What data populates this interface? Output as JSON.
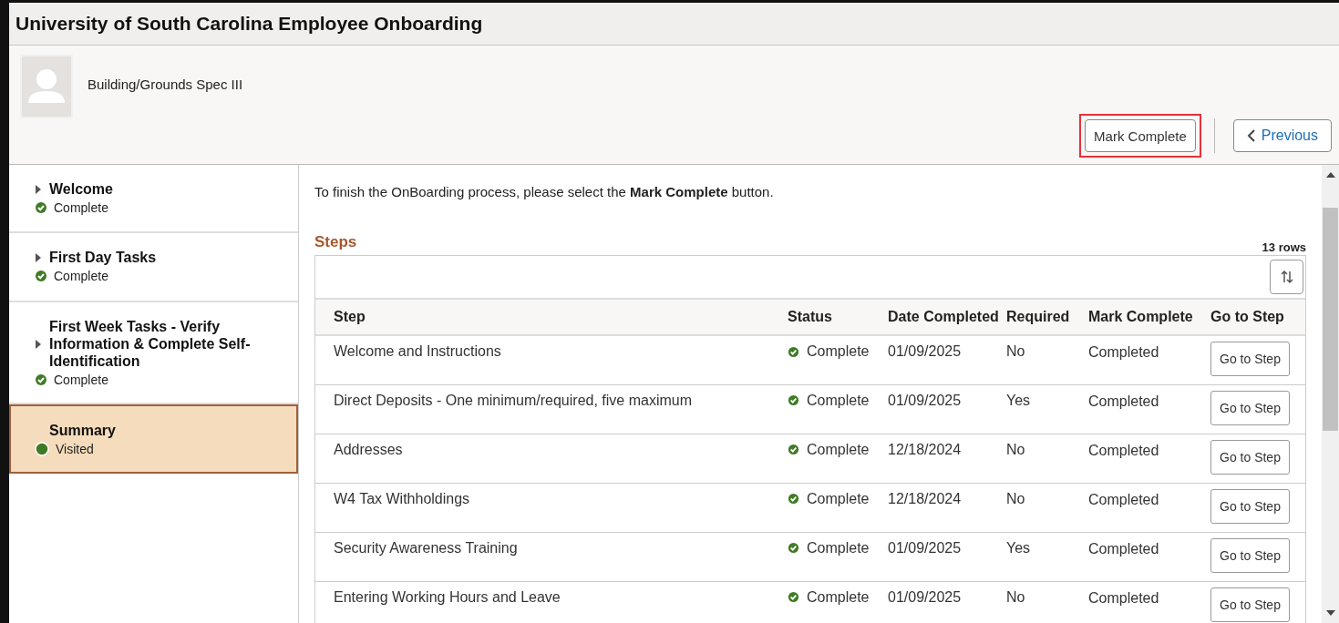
{
  "window": {
    "title": "University of South Carolina Employee Onboarding"
  },
  "header": {
    "job_title": "Building/Grounds Spec III",
    "buttons": [
      {
        "label": "Mark Complete",
        "kind": "plain",
        "highlighted": true
      },
      {
        "label": "Previous",
        "kind": "back",
        "highlighted": false
      }
    ]
  },
  "sidebar": {
    "items": [
      {
        "label": "Welcome",
        "expandable": true,
        "selected": false,
        "status": {
          "kind": "complete",
          "label": "Complete"
        }
      },
      {
        "label": "First Day Tasks",
        "expandable": true,
        "selected": false,
        "status": {
          "kind": "complete",
          "label": "Complete"
        }
      },
      {
        "label": "First Week Tasks - Verify Information & Complete Self-Identification",
        "expandable": true,
        "selected": false,
        "status": {
          "kind": "complete",
          "label": "Complete"
        }
      },
      {
        "label": "Summary",
        "expandable": false,
        "selected": true,
        "status": {
          "kind": "visited",
          "label": "Visited"
        }
      }
    ]
  },
  "instruction": "To finish the OnBoarding process, please select the **Mark Complete** button.",
  "steps": {
    "title": "Steps",
    "row_count": "13 rows",
    "columns": [
      "Step",
      "Status",
      "Date Completed",
      "Required",
      "Mark Complete",
      "Go to Step"
    ],
    "rows": [
      {
        "step": "Welcome and Instructions",
        "status": "Complete",
        "date": "01/09/2025",
        "required": "No",
        "mark": "Completed",
        "action": "Go to Step"
      },
      {
        "step": "Direct Deposits - One minimum/required, five maximum",
        "status": "Complete",
        "date": "01/09/2025",
        "required": "Yes",
        "mark": "Completed",
        "action": "Go to Step"
      },
      {
        "step": "Addresses",
        "status": "Complete",
        "date": "12/18/2024",
        "required": "No",
        "mark": "Completed",
        "action": "Go to Step"
      },
      {
        "step": "W4 Tax Withholdings",
        "status": "Complete",
        "date": "12/18/2024",
        "required": "No",
        "mark": "Completed",
        "action": "Go to Step"
      },
      {
        "step": "Security Awareness Training",
        "status": "Complete",
        "date": "01/09/2025",
        "required": "Yes",
        "mark": "Completed",
        "action": "Go to Step"
      },
      {
        "step": "Entering Working Hours and Leave",
        "status": "Complete",
        "date": "01/09/2025",
        "required": "No",
        "mark": "Completed",
        "action": "Go to Step"
      }
    ]
  }
}
